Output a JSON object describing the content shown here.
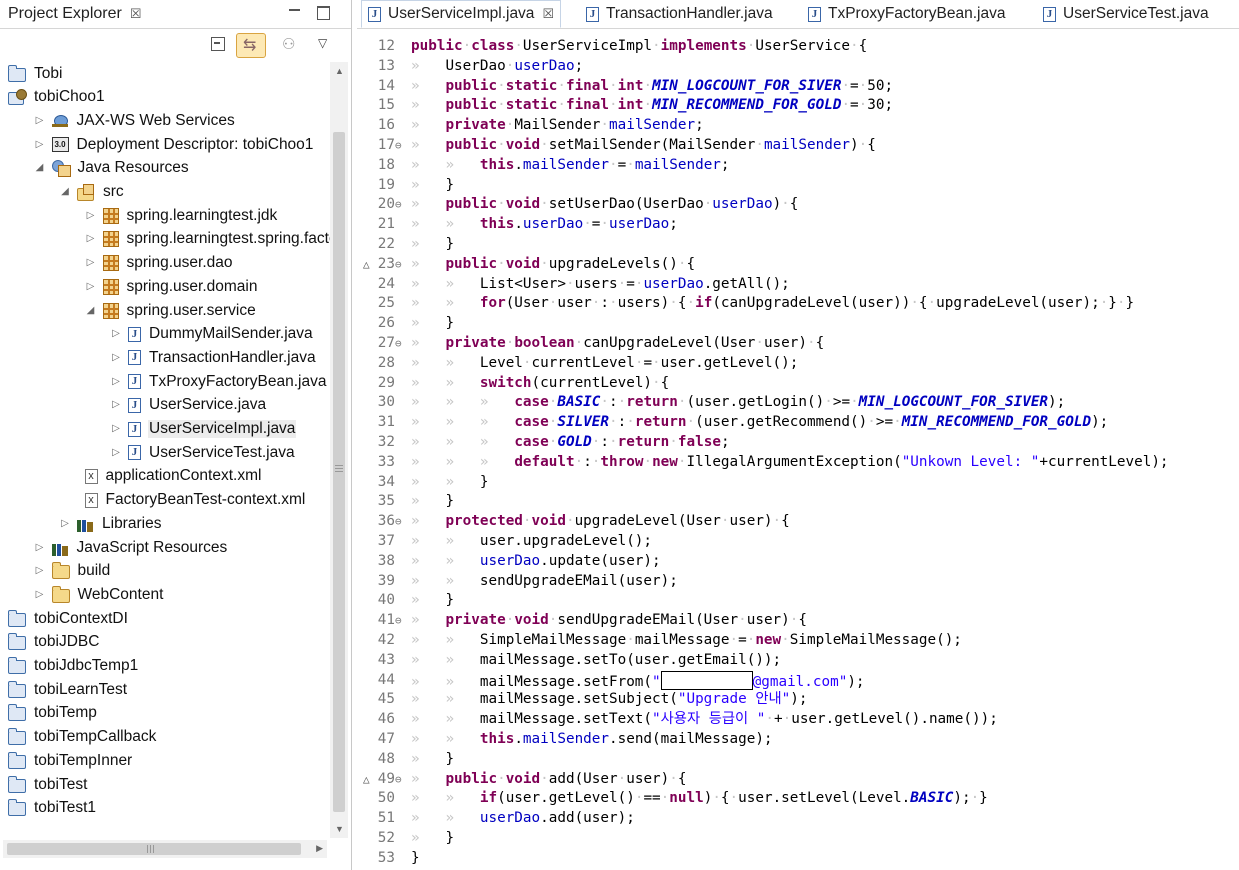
{
  "explorer": {
    "tab_label": "Project Explorer",
    "tab_close": "☒",
    "tree": [
      {
        "depth": 0,
        "arrow": "",
        "icon": "folder",
        "label": "Tobi"
      },
      {
        "depth": 0,
        "arrow": "",
        "icon": "project",
        "label": "tobiChoo1"
      },
      {
        "depth": 1,
        "arrow": "▷",
        "icon": "ws",
        "label": "JAX-WS Web Services"
      },
      {
        "depth": 1,
        "arrow": "▷",
        "icon": "dd",
        "label": "Deployment Descriptor: tobiChoo1"
      },
      {
        "depth": 1,
        "arrow": "◢",
        "icon": "jres",
        "label": "Java Resources"
      },
      {
        "depth": 2,
        "arrow": "◢",
        "icon": "src",
        "label": "src"
      },
      {
        "depth": 3,
        "arrow": "▷",
        "icon": "pkg",
        "label": "spring.learningtest.jdk"
      },
      {
        "depth": 3,
        "arrow": "▷",
        "icon": "pkg",
        "label": "spring.learningtest.spring.factc"
      },
      {
        "depth": 3,
        "arrow": "▷",
        "icon": "pkg",
        "label": "spring.user.dao"
      },
      {
        "depth": 3,
        "arrow": "▷",
        "icon": "pkg",
        "label": "spring.user.domain"
      },
      {
        "depth": 3,
        "arrow": "◢",
        "icon": "pkg",
        "label": "spring.user.service"
      },
      {
        "depth": 4,
        "arrow": "▷",
        "icon": "java",
        "label": "DummyMailSender.java"
      },
      {
        "depth": 4,
        "arrow": "▷",
        "icon": "java",
        "label": "TransactionHandler.java"
      },
      {
        "depth": 4,
        "arrow": "▷",
        "icon": "java",
        "label": "TxProxyFactoryBean.java"
      },
      {
        "depth": 4,
        "arrow": "▷",
        "icon": "java",
        "label": "UserService.java"
      },
      {
        "depth": 4,
        "arrow": "▷",
        "icon": "java",
        "label": "UserServiceImpl.java",
        "selected": true
      },
      {
        "depth": 4,
        "arrow": "▷",
        "icon": "java",
        "label": "UserServiceTest.java"
      },
      {
        "depth": 3,
        "arrow": "",
        "icon": "xml",
        "label": "applicationContext.xml"
      },
      {
        "depth": 3,
        "arrow": "",
        "icon": "xml",
        "label": "FactoryBeanTest-context.xml"
      },
      {
        "depth": 2,
        "arrow": "▷",
        "icon": "lib",
        "label": "Libraries"
      },
      {
        "depth": 1,
        "arrow": "▷",
        "icon": "lib",
        "label": "JavaScript Resources"
      },
      {
        "depth": 1,
        "arrow": "▷",
        "icon": "yfolder",
        "label": "build"
      },
      {
        "depth": 1,
        "arrow": "▷",
        "icon": "yfolder",
        "label": "WebContent"
      },
      {
        "depth": 0,
        "arrow": "",
        "icon": "folder",
        "label": "tobiContextDI"
      },
      {
        "depth": 0,
        "arrow": "",
        "icon": "folder",
        "label": "tobiJDBC"
      },
      {
        "depth": 0,
        "arrow": "",
        "icon": "folder",
        "label": "tobiJdbcTemp1"
      },
      {
        "depth": 0,
        "arrow": "",
        "icon": "folder",
        "label": "tobiLearnTest"
      },
      {
        "depth": 0,
        "arrow": "",
        "icon": "folder",
        "label": "tobiTemp"
      },
      {
        "depth": 0,
        "arrow": "",
        "icon": "folder",
        "label": "tobiTempCallback"
      },
      {
        "depth": 0,
        "arrow": "",
        "icon": "folder",
        "label": "tobiTempInner"
      },
      {
        "depth": 0,
        "arrow": "",
        "icon": "folder",
        "label": "tobiTest"
      },
      {
        "depth": 0,
        "arrow": "",
        "icon": "folder",
        "label": "tobiTest1"
      }
    ],
    "hscroll_grip": "III"
  },
  "editor": {
    "tabs": [
      {
        "label": "UserServiceImpl.java",
        "close": "☒",
        "active": true
      },
      {
        "label": "TransactionHandler.java"
      },
      {
        "label": "TxProxyFactoryBean.java"
      },
      {
        "label": "UserServiceTest.java"
      }
    ],
    "lines": [
      {
        "n": "12",
        "t": "public class UserServiceImpl implements UserService {"
      },
      {
        "n": "13",
        "t": "    UserDao userDao;"
      },
      {
        "n": "14",
        "t": "    public static final int MIN_LOGCOUNT_FOR_SIVER = 50;"
      },
      {
        "n": "15",
        "t": "    public static final int MIN_RECOMMEND_FOR_GOLD = 30;"
      },
      {
        "n": "16",
        "t": "    private MailSender mailSender;"
      },
      {
        "n": "17",
        "fold": "⊖",
        "t": "    public void setMailSender(MailSender mailSender) {"
      },
      {
        "n": "18",
        "t": "        this.mailSender = mailSender;"
      },
      {
        "n": "19",
        "t": "    }"
      },
      {
        "n": "20",
        "fold": "⊖",
        "t": "    public void setUserDao(UserDao userDao) {"
      },
      {
        "n": "21",
        "t": "        this.userDao = userDao;"
      },
      {
        "n": "22",
        "t": "    }"
      },
      {
        "n": "23",
        "fold": "⊖",
        "marker": "△",
        "t": "    public void upgradeLevels() {"
      },
      {
        "n": "24",
        "t": "        List<User> users = userDao.getAll();"
      },
      {
        "n": "25",
        "t": "        for(User user : users) { if(canUpgradeLevel(user)) { upgradeLevel(user); } }"
      },
      {
        "n": "26",
        "t": "    }"
      },
      {
        "n": "27",
        "fold": "⊖",
        "t": "    private boolean canUpgradeLevel(User user) {"
      },
      {
        "n": "28",
        "t": "        Level currentLevel = user.getLevel();"
      },
      {
        "n": "29",
        "t": "        switch(currentLevel) {"
      },
      {
        "n": "30",
        "t": "            case BASIC : return (user.getLogin() >= MIN_LOGCOUNT_FOR_SIVER);"
      },
      {
        "n": "31",
        "t": "            case SILVER : return (user.getRecommend() >= MIN_RECOMMEND_FOR_GOLD);"
      },
      {
        "n": "32",
        "t": "            case GOLD : return false;"
      },
      {
        "n": "33",
        "t": "            default : throw new IllegalArgumentException(\"Unkown Level: \"+currentLevel);"
      },
      {
        "n": "34",
        "t": "        }"
      },
      {
        "n": "35",
        "t": "    }"
      },
      {
        "n": "36",
        "fold": "⊖",
        "t": "    protected void upgradeLevel(User user) {"
      },
      {
        "n": "37",
        "t": "        user.upgradeLevel();"
      },
      {
        "n": "38",
        "t": "        userDao.update(user);"
      },
      {
        "n": "39",
        "t": "        sendUpgradeEMail(user);"
      },
      {
        "n": "40",
        "t": "    }"
      },
      {
        "n": "41",
        "fold": "⊖",
        "t": "    private void sendUpgradeEMail(User user) {"
      },
      {
        "n": "42",
        "t": "        SimpleMailMessage mailMessage = new SimpleMailMessage();"
      },
      {
        "n": "43",
        "t": "        mailMessage.setTo(user.getEmail());"
      },
      {
        "n": "44",
        "t": "        mailMessage.setFrom(\"[[REDACTED]]@gmail.com\");"
      },
      {
        "n": "45",
        "t": "        mailMessage.setSubject(\"Upgrade 안내\");"
      },
      {
        "n": "46",
        "t": "        mailMessage.setText(\"사용자 등급이 \" + user.getLevel().name());"
      },
      {
        "n": "47",
        "t": "        this.mailSender.send(mailMessage);"
      },
      {
        "n": "48",
        "t": "    }"
      },
      {
        "n": "49",
        "fold": "⊖",
        "marker": "△",
        "t": "    public void add(User user) {"
      },
      {
        "n": "50",
        "t": "        if(user.getLevel() == null) { user.setLevel(Level.BASIC); }"
      },
      {
        "n": "51",
        "t": "        userDao.add(user);"
      },
      {
        "n": "52",
        "t": "    }"
      },
      {
        "n": "53",
        "t": "}"
      }
    ]
  },
  "colors": {
    "keyword": "#7f0055",
    "field": "#0000c0",
    "string": "#2a00ff",
    "line_number": "#787878"
  }
}
